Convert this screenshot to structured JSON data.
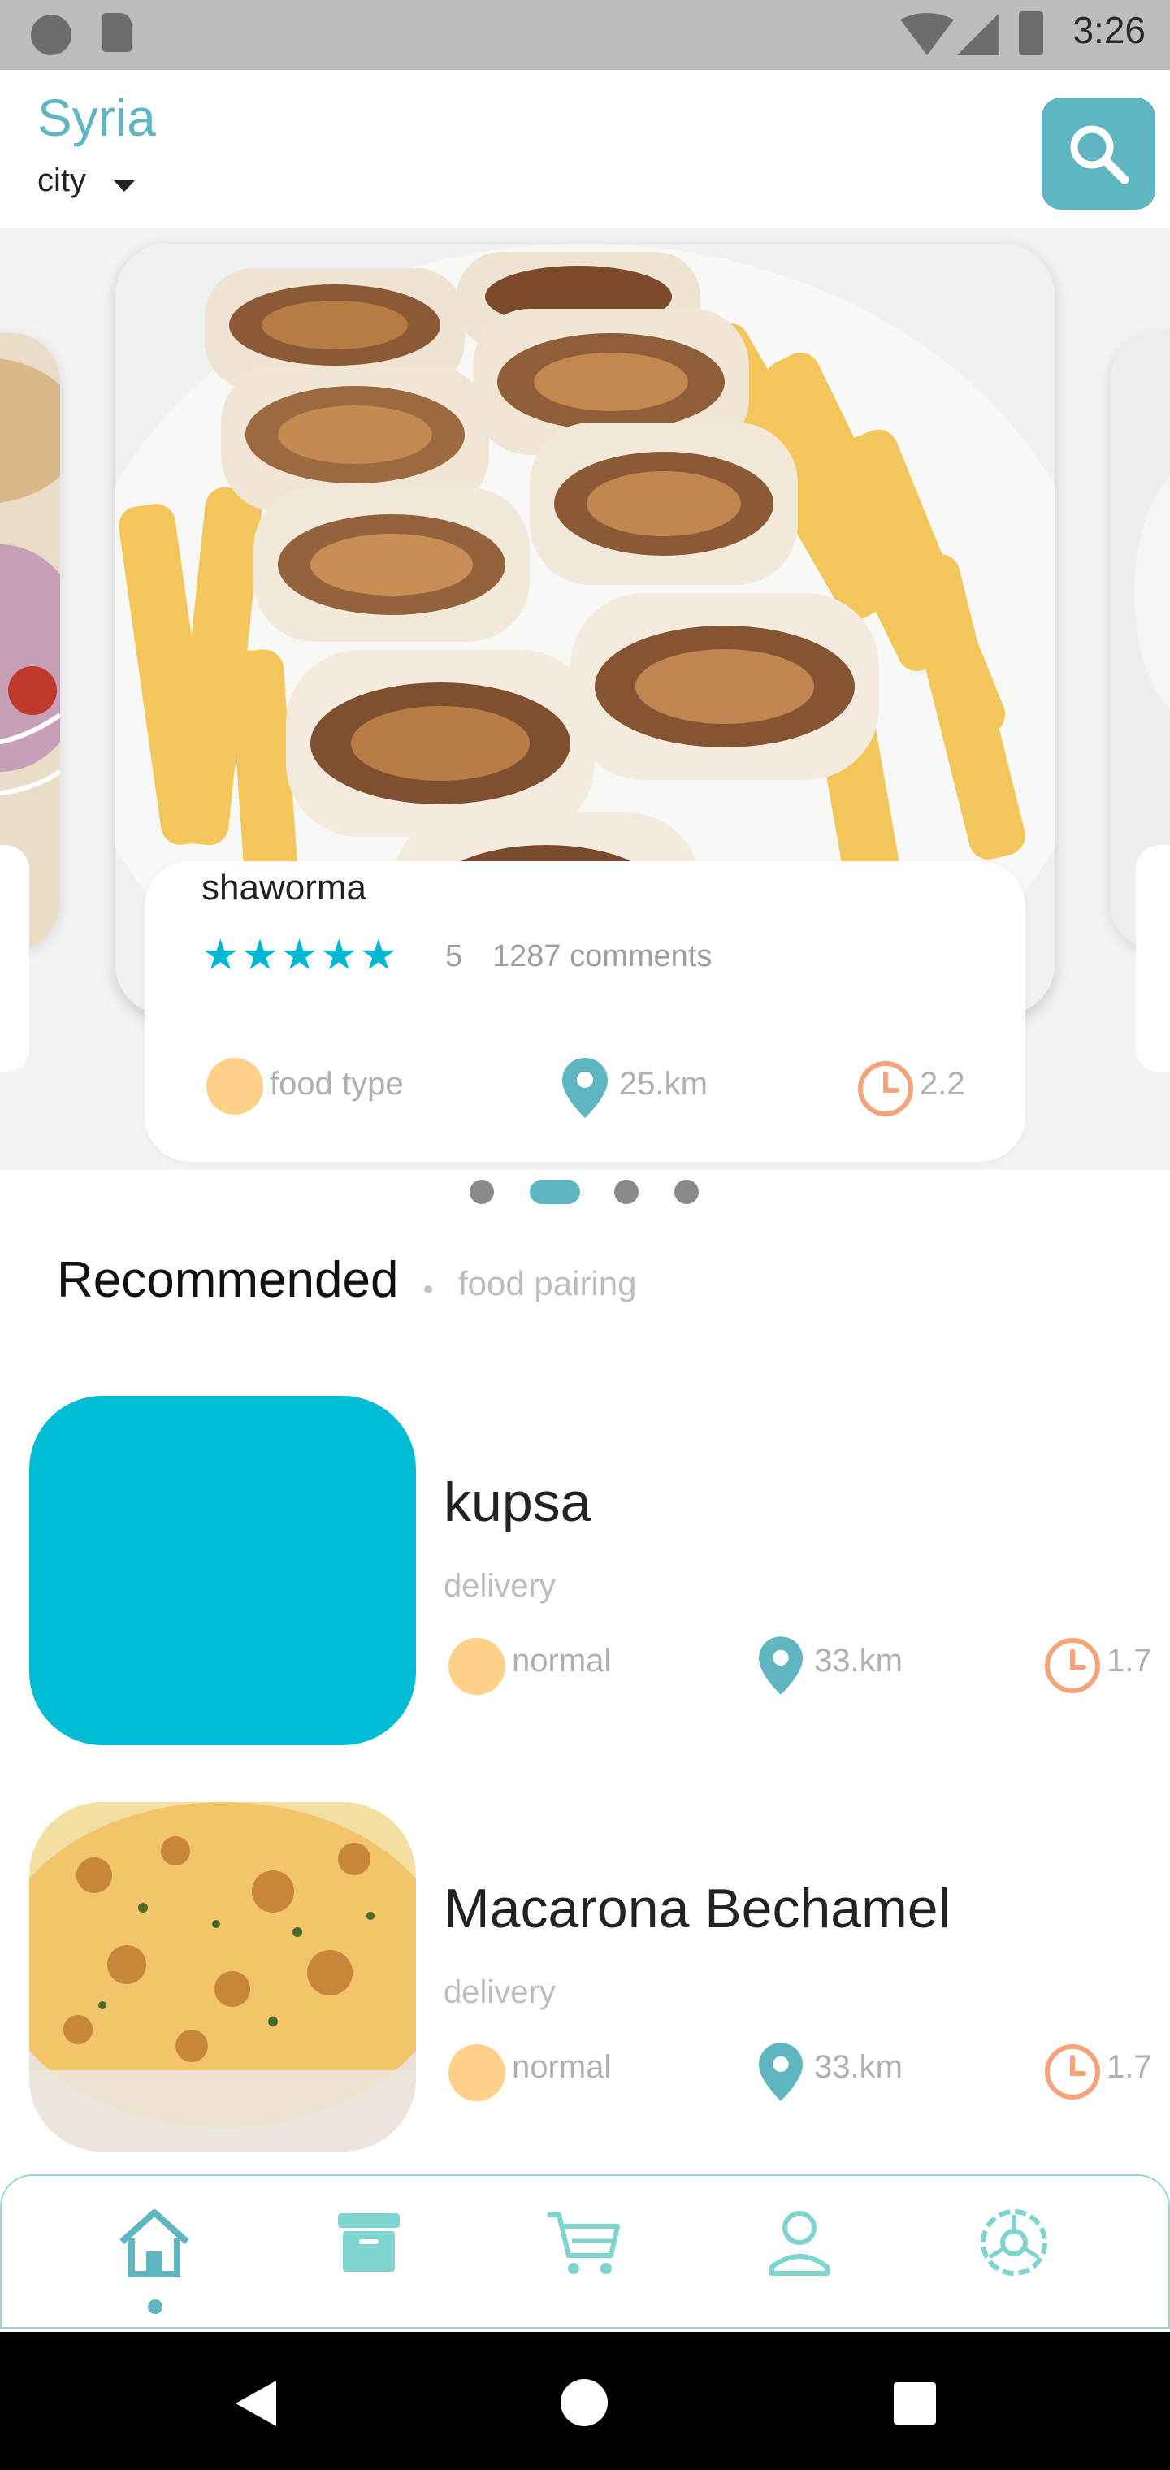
{
  "status_bar": {
    "time": "3:26"
  },
  "header": {
    "country": "Syria",
    "city_label": "city"
  },
  "featured": {
    "title": "shaworma",
    "stars": "★★★★★",
    "rating": "5",
    "comments": "1287 comments",
    "food_type": "food type",
    "distance": "25.km",
    "time": "2.2"
  },
  "section": {
    "title": "Recommended",
    "subtitle": "food pairing"
  },
  "list": [
    {
      "title": "kupsa",
      "subtitle": "delivery",
      "type": "normal",
      "distance": "33.km",
      "time": "1.7",
      "image_color": "#00bcd4"
    },
    {
      "title": "Macarona Bechamel",
      "subtitle": "delivery",
      "type": "normal",
      "distance": "33.km",
      "time": "1.7"
    }
  ],
  "bottom_nav": [
    "home-icon",
    "archive-icon",
    "cart-icon",
    "profile-icon",
    "settings-icon"
  ],
  "colors": {
    "accent": "#5fb5c0",
    "star": "#00b8d4",
    "orange": "#ffd08a",
    "clock": "#f5a37a"
  }
}
